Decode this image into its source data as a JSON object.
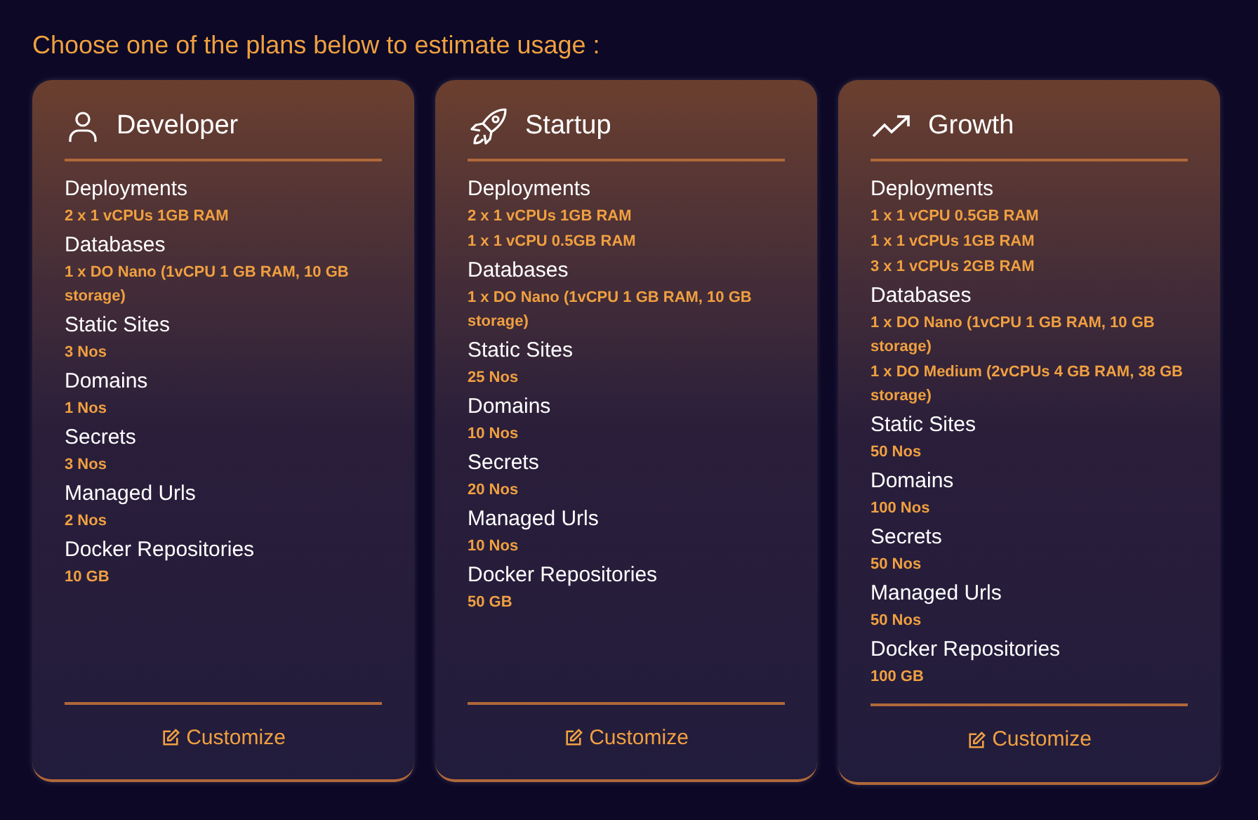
{
  "heading": "Choose one of the plans below to estimate usage :",
  "plans": [
    {
      "kind": "person",
      "name": "Developer",
      "sections": [
        {
          "label": "Deployments",
          "values": [
            "2 x 1 vCPUs 1GB RAM"
          ]
        },
        {
          "label": "Databases",
          "values": [
            "1 x DO Nano (1vCPU 1 GB RAM, 10 GB storage)"
          ]
        },
        {
          "label": "Static Sites",
          "values": [
            "3 Nos"
          ]
        },
        {
          "label": "Domains",
          "values": [
            "1 Nos"
          ]
        },
        {
          "label": "Secrets",
          "values": [
            "3 Nos"
          ]
        },
        {
          "label": "Managed Urls",
          "values": [
            "2 Nos"
          ]
        },
        {
          "label": "Docker Repositories",
          "values": [
            "10 GB"
          ]
        }
      ],
      "action": "Customize"
    },
    {
      "kind": "rocket",
      "name": "Startup",
      "sections": [
        {
          "label": "Deployments",
          "values": [
            "2 x 1 vCPUs 1GB RAM",
            "1 x 1 vCPU 0.5GB RAM"
          ]
        },
        {
          "label": "Databases",
          "values": [
            "1 x DO Nano (1vCPU 1 GB RAM, 10 GB storage)"
          ]
        },
        {
          "label": "Static Sites",
          "values": [
            "25 Nos"
          ]
        },
        {
          "label": "Domains",
          "values": [
            "10 Nos"
          ]
        },
        {
          "label": "Secrets",
          "values": [
            "20 Nos"
          ]
        },
        {
          "label": "Managed Urls",
          "values": [
            "10 Nos"
          ]
        },
        {
          "label": "Docker Repositories",
          "values": [
            "50 GB"
          ]
        }
      ],
      "action": "Customize"
    },
    {
      "kind": "trend",
      "name": "Growth",
      "sections": [
        {
          "label": "Deployments",
          "values": [
            "1 x 1 vCPU 0.5GB RAM",
            "1 x 1 vCPUs 1GB RAM",
            "3 x 1 vCPUs 2GB RAM"
          ]
        },
        {
          "label": "Databases",
          "values": [
            "1 x DO Nano (1vCPU 1 GB RAM, 10 GB storage)",
            "1 x DO Medium (2vCPUs 4 GB RAM, 38 GB storage)"
          ]
        },
        {
          "label": "Static Sites",
          "values": [
            "50 Nos"
          ]
        },
        {
          "label": "Domains",
          "values": [
            "100 Nos"
          ]
        },
        {
          "label": "Secrets",
          "values": [
            "50 Nos"
          ]
        },
        {
          "label": "Managed Urls",
          "values": [
            "50 Nos"
          ]
        },
        {
          "label": "Docker Repositories",
          "values": [
            "100 GB"
          ]
        }
      ],
      "action": "Customize"
    }
  ]
}
